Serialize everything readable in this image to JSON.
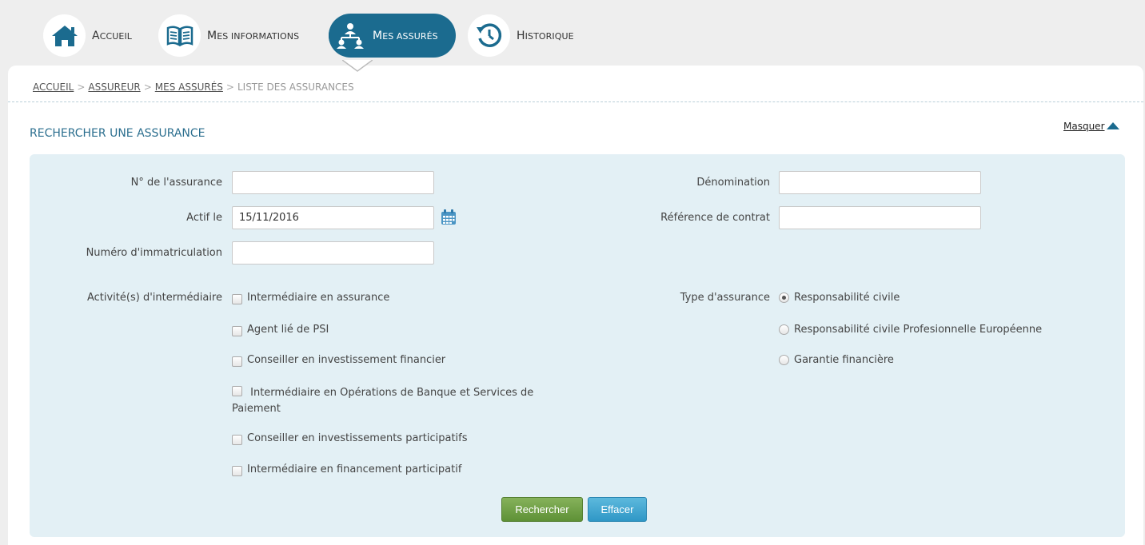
{
  "nav": {
    "items": [
      {
        "cap": "A",
        "label": "ccueil",
        "icon": "home-icon"
      },
      {
        "cap": "M",
        "label": "es informations",
        "icon": "book-icon"
      },
      {
        "cap": "M",
        "label": "es assurés",
        "icon": "people-hierarchy-icon",
        "active": true
      },
      {
        "cap": "H",
        "label": "istorique",
        "icon": "history-icon"
      }
    ]
  },
  "breadcrumb": {
    "items": [
      "ACCUEIL",
      "ASSUREUR",
      "MES ASSURÉS"
    ],
    "current": "LISTE DES ASSURANCES",
    "separator": ">"
  },
  "search": {
    "title": "RECHERCHER UNE ASSURANCE",
    "toggle_label": "Masquer",
    "fields": {
      "numero_label": "N° de l'assurance",
      "numero_value": "",
      "actif_label": "Actif le",
      "actif_value": "15/11/2016",
      "immat_label": "Numéro d'immatriculation",
      "immat_value": "",
      "denomination_label": "Dénomination",
      "denomination_value": "",
      "reference_label": "Référence de contrat",
      "reference_value": ""
    },
    "activites": {
      "label": "Activité(s) d'intermédiaire",
      "options": [
        "Intermédiaire en assurance",
        "Agent lié de PSI",
        "Conseiller en investissement financier",
        "Intermédiaire en Opérations de Banque et Services de Paiement",
        "Conseiller en investissements participatifs",
        "Intermédiaire en financement participatif"
      ]
    },
    "type_assurance": {
      "label": "Type d'assurance",
      "options": [
        "Responsabilité civile",
        "Responsabilité civile Profesionnelle Européenne",
        "Garantie financière"
      ],
      "selected": "Responsabilité civile"
    },
    "buttons": {
      "search": "Rechercher",
      "clear": "Effacer"
    }
  },
  "colors": {
    "primary": "#1b6b8f",
    "form_bg": "#e3f0f5",
    "search_btn": "#6fa046",
    "clear_btn": "#3ea6d2"
  }
}
